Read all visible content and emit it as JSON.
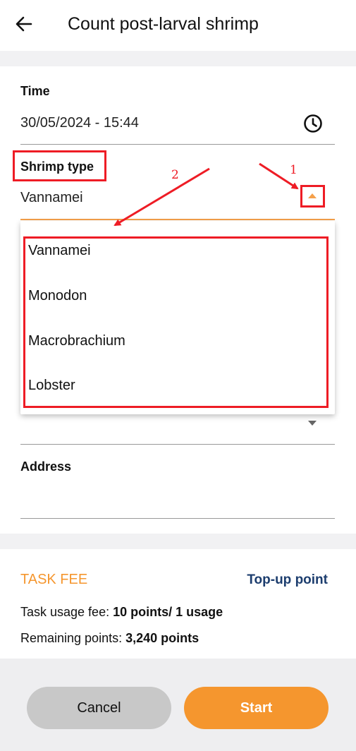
{
  "header": {
    "title": "Count post-larval shrimp",
    "back_icon": "arrow-left-icon"
  },
  "form": {
    "time": {
      "label": "Time",
      "value": "30/05/2024 - 15:44",
      "icon": "clock-icon"
    },
    "shrimp_type": {
      "label": "Shrimp type",
      "value": "Vannamei",
      "options": [
        "Vannamei",
        "Monodon",
        "Macrobrachium",
        "Lobster"
      ]
    },
    "address": {
      "label": "Address",
      "value": ""
    }
  },
  "annotations": {
    "label_1": "1",
    "label_2": "2",
    "color": "#ee1c25"
  },
  "fee": {
    "title": "TASK FEE",
    "topup_label": "Top-up point",
    "usage_label": "Task usage fee: ",
    "usage_value": "10 points/ 1 usage",
    "remaining_label": "Remaining points: ",
    "remaining_value": "3,240 points"
  },
  "footer": {
    "cancel_label": "Cancel",
    "start_label": "Start"
  },
  "colors": {
    "accent": "#f5962e",
    "link": "#1c3d6e",
    "highlight": "#ee1c25"
  }
}
